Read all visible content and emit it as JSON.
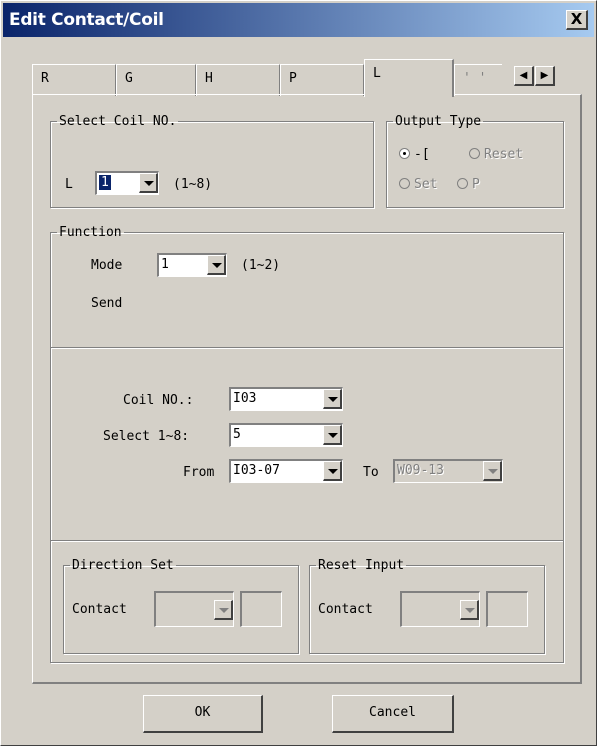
{
  "window": {
    "title": "Edit Contact/Coil",
    "close_symbol": "X"
  },
  "tabs": [
    {
      "label": "R",
      "active": false
    },
    {
      "label": "G",
      "active": false
    },
    {
      "label": "H",
      "active": false
    },
    {
      "label": "P",
      "active": false
    },
    {
      "label": "L",
      "active": true
    },
    {
      "label": "' '",
      "active": false
    }
  ],
  "tab_scroll": {
    "left": "◀",
    "right": "▶"
  },
  "select_coil": {
    "legend": "Select Coil NO.",
    "prefix": "L",
    "value": "1",
    "range": "(1~8)"
  },
  "output_type": {
    "legend": "Output Type",
    "options": [
      {
        "label": "-[",
        "checked": true,
        "enabled": true
      },
      {
        "label": "Reset",
        "checked": false,
        "enabled": false
      },
      {
        "label": "Set",
        "checked": false,
        "enabled": false
      },
      {
        "label": "P",
        "checked": false,
        "enabled": false
      }
    ]
  },
  "function": {
    "legend": "Function",
    "mode_label": "Mode",
    "mode_value": "1",
    "mode_range": "(1~2)",
    "description": "Send"
  },
  "params": {
    "coil_no_label": "Coil NO.:",
    "coil_no_value": "I03",
    "select_label": "Select 1~8:",
    "select_value": "5",
    "from_label": "From",
    "from_value": "I03-07",
    "to_label": "To",
    "to_value": "W09-13"
  },
  "direction_set": {
    "legend": "Direction Set",
    "contact_label": "Contact"
  },
  "reset_input": {
    "legend": "Reset Input",
    "contact_label": "Contact"
  },
  "buttons": {
    "ok": "OK",
    "cancel": "Cancel"
  }
}
